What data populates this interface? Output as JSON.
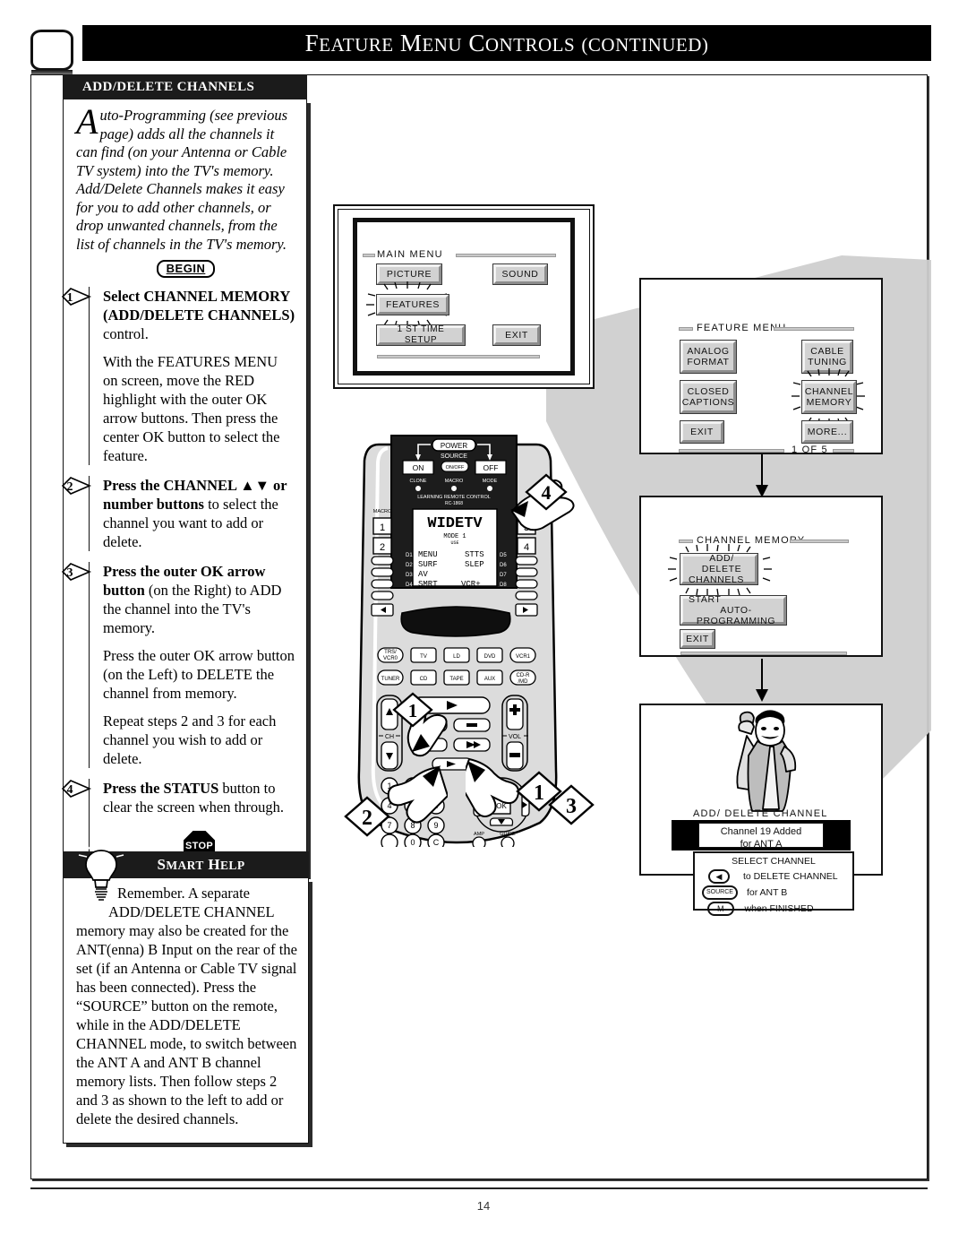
{
  "header": {
    "title_words": [
      "F",
      "EATURE",
      " M",
      "ENU",
      " C",
      "ONTROLS",
      " (",
      "CONTINUED",
      ")"
    ],
    "title_main": "Feature Menu Controls (continued)",
    "tv_icon": "tv-screen-icon"
  },
  "page": {
    "number": "14"
  },
  "left_panel": {
    "header": "ADD/DELETE CHANNELS",
    "intro_dropcap": "A",
    "intro_text": "uto-Programming (see previous page) adds all the channels it can find (on your Antenna or Cable TV system) into the TV's memory. Add/Delete Channels makes it easy for you to add other channels, or drop unwanted channels, from the list of channels in the TV's memory.",
    "begin_label": "BEGIN",
    "stop_label": "STOP",
    "steps": [
      {
        "number": "1",
        "lead_bold": "Select CHANNEL MEMORY (ADD/DELETE CHANNELS)",
        "lead_rest": " control.",
        "extra": "With the FEATURES MENU on screen, move the RED highlight with the outer OK arrow buttons. Then press the center OK button to select the feature."
      },
      {
        "number": "2",
        "lead_bold": "Press the CHANNEL ▲▼ or number buttons",
        "lead_rest": " to select the channel you want to add or delete.",
        "extra": ""
      },
      {
        "number": "3",
        "lead_bold": "Press the outer OK arrow button",
        "lead_rest": " (on the Right) to ADD the channel into the TV's memory.",
        "extra": "Press the outer OK arrow button (on the Left) to DELETE the channel from memory.",
        "extra2": "Repeat steps 2 and 3 for each channel you wish to add or delete."
      },
      {
        "number": "4",
        "lead_bold": "Press the STATUS",
        "lead_rest": " button to clear the screen when through.",
        "extra": ""
      }
    ]
  },
  "smart_help": {
    "header": "SMART HELP",
    "icon": "lightbulb-icon",
    "line1": "Remember. A separate",
    "line2": "ADD/DELETE CHANNEL",
    "body": "memory may also be created for the ANT(enna) B Input on the rear of the set (if an Antenna or Cable TV signal has been connected). Press the “SOURCE” button on the remote, while in the ADD/DELETE CHANNEL mode, to switch between the ANT A and ANT B channel memory lists. Then follow steps 2 and 3 as shown to the left to add or delete the desired channels."
  },
  "main_menu": {
    "title": "MAIN MENU",
    "buttons": [
      {
        "label": "PICTURE",
        "highlighted": false
      },
      {
        "label": "SOUND",
        "highlighted": false
      },
      {
        "label": "FEATURES",
        "highlighted": true
      },
      {
        "label": "1 ST TIME SETUP",
        "highlighted": false
      },
      {
        "label": "EXIT",
        "highlighted": false
      }
    ]
  },
  "feature_menu": {
    "title": "FEATURE MENU",
    "page_indicator": "1  OF 5",
    "buttons": [
      {
        "line1": "ANALOG",
        "line2": "FORMAT",
        "highlighted": false
      },
      {
        "line1": "CABLE",
        "line2": "TUNING",
        "highlighted": false
      },
      {
        "line1": "CLOSED",
        "line2": "CAPTIONS",
        "highlighted": false
      },
      {
        "line1": "CHANNEL",
        "line2": "MEMORY",
        "highlighted": true
      },
      {
        "line1": "EXIT",
        "line2": "",
        "highlighted": false
      },
      {
        "line1": "MORE...",
        "line2": "",
        "highlighted": false
      }
    ]
  },
  "channel_memory": {
    "title": "CHANNEL MEMORY",
    "buttons": [
      {
        "line1": "ADD/ DELETE",
        "line2": "CHANNELS",
        "highlighted": true
      },
      {
        "line1": "START",
        "line2": "AUTO-PROGRAMMING",
        "highlighted": false
      },
      {
        "line1": "EXIT",
        "line2": "",
        "highlighted": false
      }
    ]
  },
  "add_delete_screen": {
    "title": "ADD/ DELETE CHANNEL",
    "status_line1": "Channel 19 Added",
    "status_line2": "for ANT A",
    "legend_title": "SELECT CHANNEL",
    "legend": [
      {
        "key": "◀",
        "key_type": "arrow-left-button",
        "text": "to DELETE CHANNEL"
      },
      {
        "key": "SOURCE",
        "key_type": "source-button",
        "text": "for ANT B"
      },
      {
        "key": "M",
        "key_type": "menu-button",
        "text": "when FINISHED"
      }
    ],
    "figure": "person-cheering-illustration"
  },
  "remote": {
    "brand_line1": "LEARNING REMOTE CONTROL",
    "brand_line2": "RC-1868",
    "power_label": "POWER",
    "source_label": "SOURCE",
    "on_label": "ON",
    "off_label": "OFF",
    "onoff_label": "ON/OFF",
    "led_labels": [
      "CLONE",
      "MACRO",
      "MODE"
    ],
    "macro_label": "MACRO",
    "lcd": {
      "brand": "WIDETV",
      "mode": "MODE 1",
      "use": "USE",
      "left_keys": [
        "MENU",
        "SURF",
        "AV",
        "SMRT"
      ],
      "right_keys": [
        "STTS",
        "SLEP",
        "",
        "VCR+"
      ],
      "left_codes": [
        "D1",
        "D2",
        "D3",
        "D4"
      ],
      "right_codes": [
        "D5",
        "D6",
        "D7",
        "D8"
      ]
    },
    "side_keys": [
      "1",
      "2",
      "3",
      "4"
    ],
    "device_row1": [
      "TRS/VCR0",
      "TV",
      "LD",
      "DVD",
      "VCR1"
    ],
    "device_row2": [
      "TUNER",
      "CD",
      "TAPE",
      "AUX",
      "CD-R/MD"
    ],
    "ch_label": "CH",
    "vol_label": "VOL",
    "ok_label": "OK",
    "keypad": [
      "1",
      "2",
      "3",
      "4",
      "5",
      "6",
      "7",
      "8",
      "9",
      "0",
      "C"
    ],
    "amp_label": "AMP",
    "guide_label": "GUIDE"
  },
  "callouts": [
    {
      "number": "1",
      "position": "ok-arrow-right"
    },
    {
      "number": "2",
      "position": "number-keypad"
    },
    {
      "number": "3",
      "position": "ok-arrow-right-outer"
    },
    {
      "number": "4",
      "position": "lcd-d5-key"
    },
    {
      "number": "1",
      "position": "channel-down-key"
    }
  ]
}
